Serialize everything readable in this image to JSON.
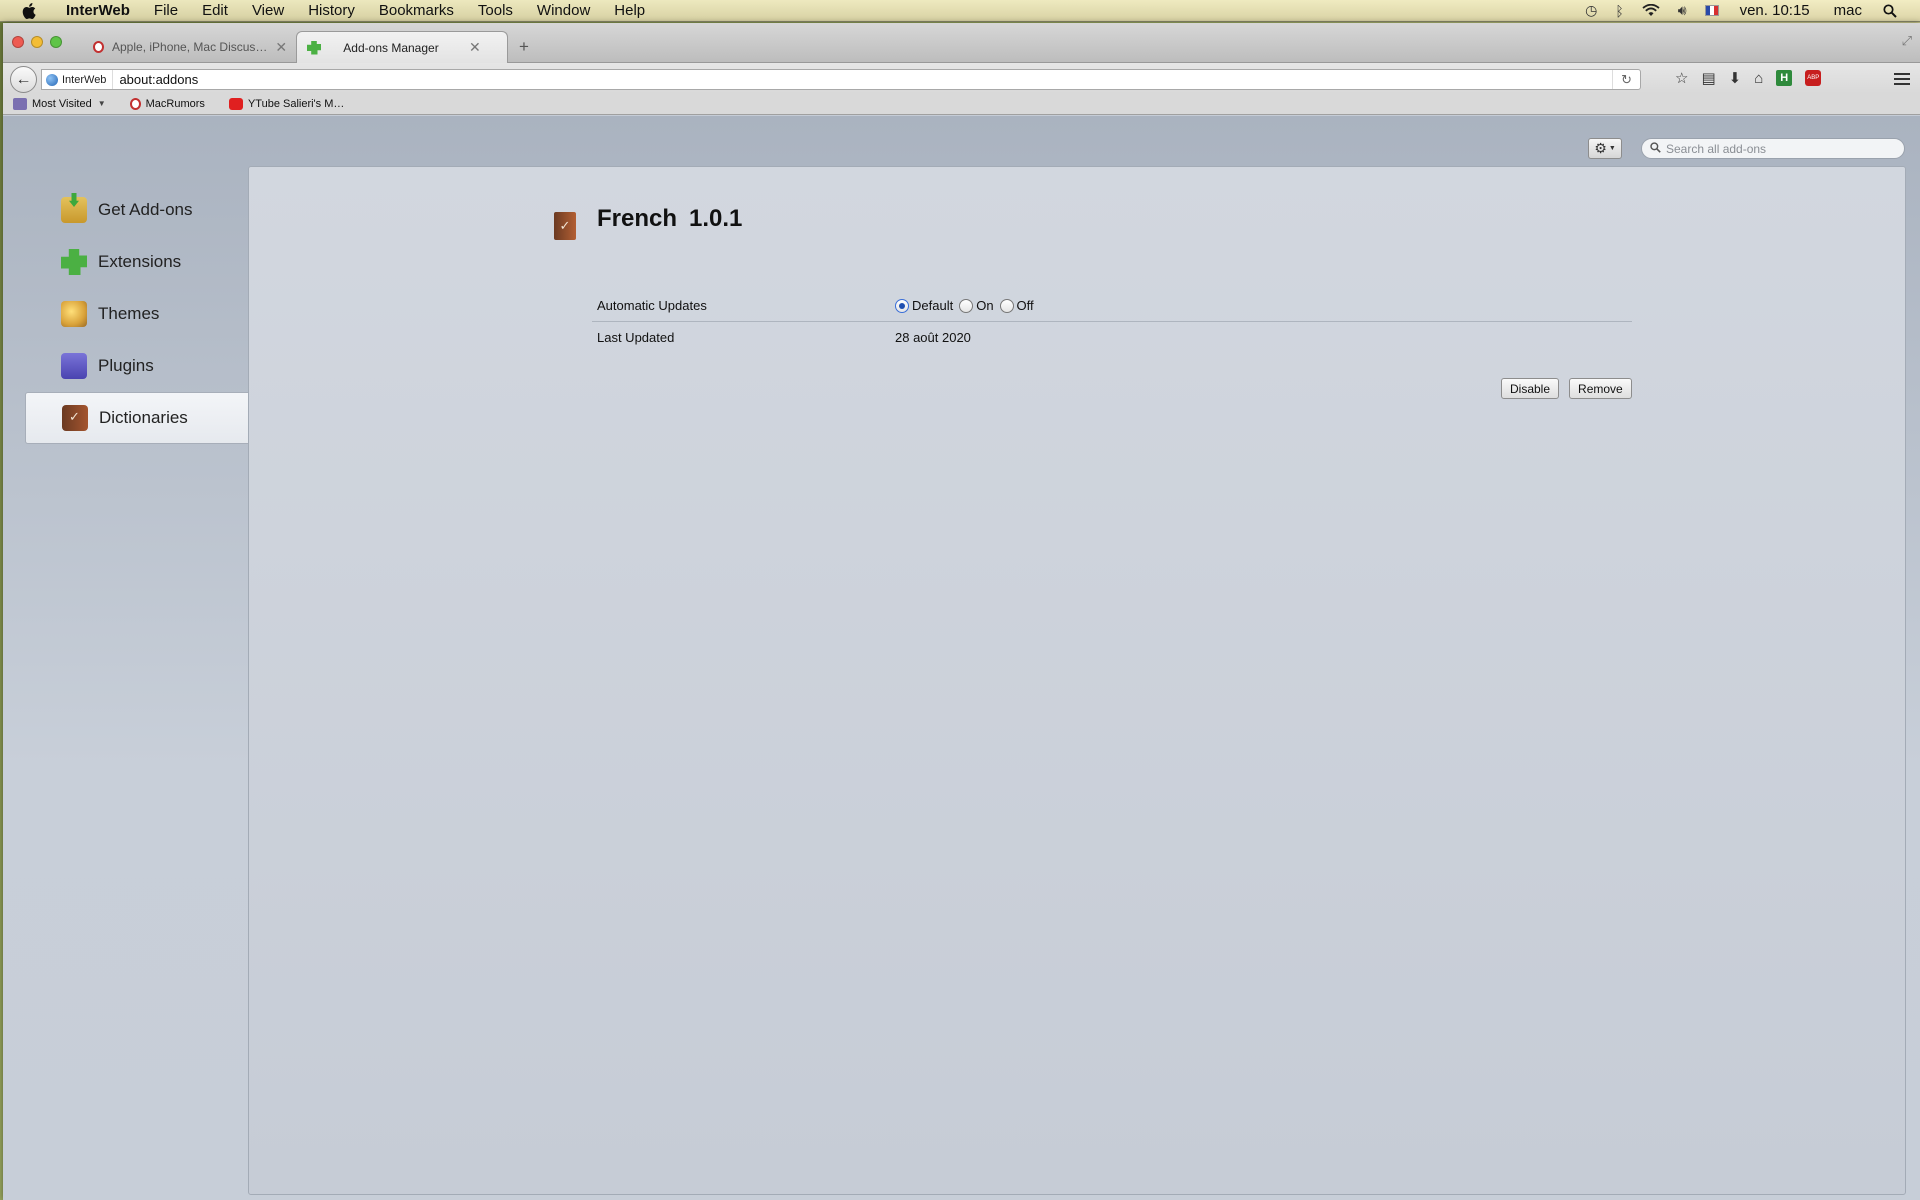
{
  "menubar": {
    "app_name": "InterWeb",
    "items": [
      "File",
      "Edit",
      "View",
      "History",
      "Bookmarks",
      "Tools",
      "Window",
      "Help"
    ],
    "clock": "ven. 10:15",
    "user": "mac"
  },
  "tabs": [
    {
      "label": "Apple, iPhone, Mac Discus…",
      "active": false
    },
    {
      "label": "Add-ons Manager",
      "active": true
    }
  ],
  "navbar": {
    "identity_label": "InterWeb",
    "url": "about:addons"
  },
  "bookmarks": [
    {
      "label": "Most Visited",
      "icon": "folder-icon"
    },
    {
      "label": "MacRumors",
      "icon": "macrumors-icon"
    },
    {
      "label": "YTube Salieri's M…",
      "icon": "youtube-icon"
    }
  ],
  "search": {
    "placeholder": "Search all add-ons"
  },
  "sidebar": {
    "items": [
      {
        "label": "Get Add-ons",
        "icon": "get-addons-icon",
        "selected": false
      },
      {
        "label": "Extensions",
        "icon": "puzzle-icon",
        "selected": false
      },
      {
        "label": "Themes",
        "icon": "palette-icon",
        "selected": false
      },
      {
        "label": "Plugins",
        "icon": "plugin-brick-icon",
        "selected": false
      },
      {
        "label": "Dictionaries",
        "icon": "dictionary-book-icon",
        "selected": true
      }
    ]
  },
  "detail": {
    "name": "French",
    "version": "1.0.1",
    "prefs": {
      "auto_updates": {
        "label": "Automatic Updates",
        "options": [
          "Default",
          "On",
          "Off"
        ],
        "selected": "Default"
      },
      "last_updated": {
        "label": "Last Updated",
        "value": "28 août 2020"
      }
    },
    "actions": {
      "disable_label": "Disable",
      "remove_label": "Remove"
    }
  },
  "colors": {
    "selected_radio": "#1f4fb0",
    "close_light": "#ee5b52",
    "minimize_light": "#f3bd35",
    "maximize_light": "#5fc447"
  }
}
